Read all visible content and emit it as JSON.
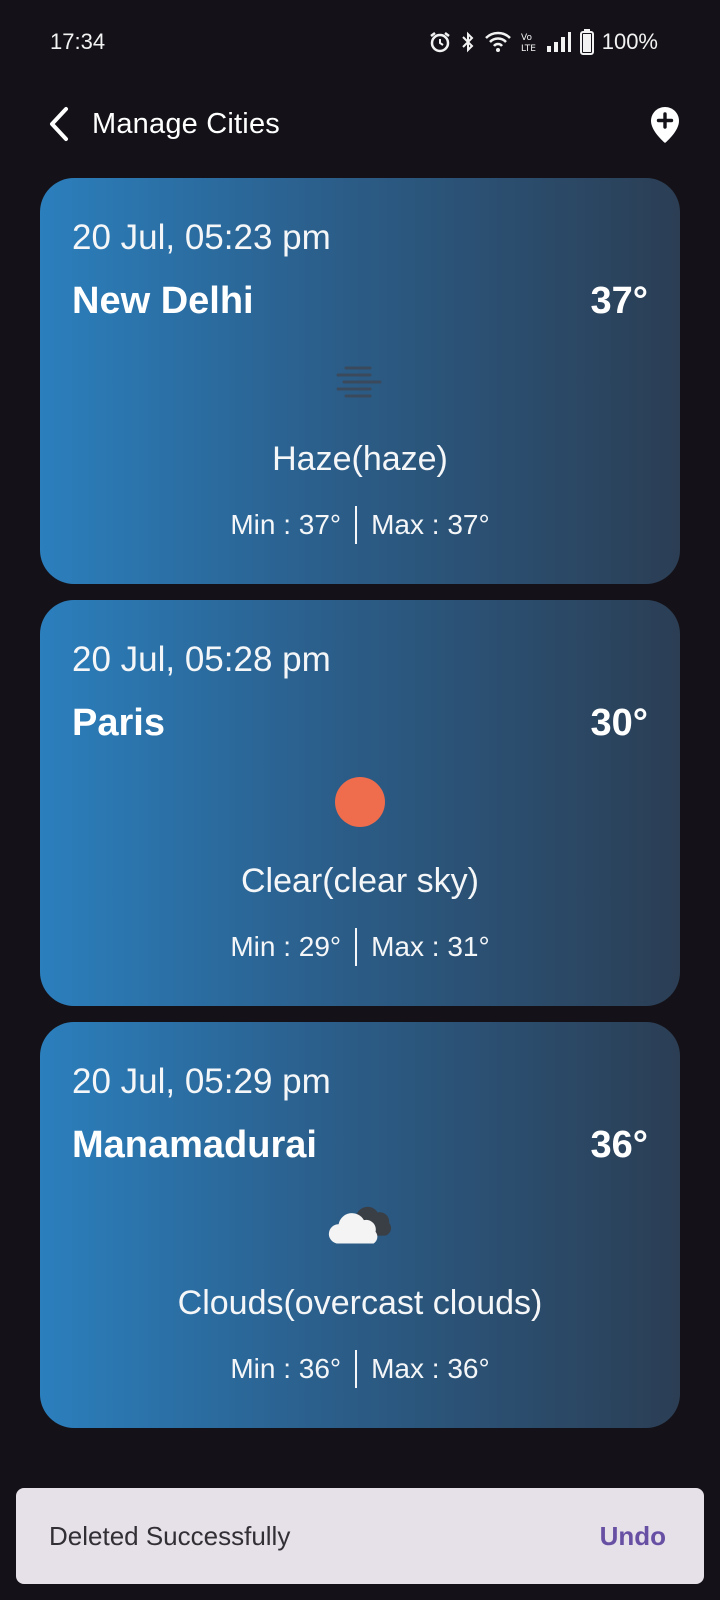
{
  "status_bar": {
    "time": "17:34",
    "battery": "100%",
    "icons": [
      "alarm-icon",
      "bluetooth-icon",
      "wifi-icon",
      "volte-icon",
      "signal-icon",
      "battery-icon"
    ]
  },
  "header": {
    "title": "Manage Cities",
    "back_icon": "chevron-left-icon",
    "add_icon": "add-location-icon"
  },
  "cities": [
    {
      "datetime": "20 Jul, 05:23 pm",
      "name": "New Delhi",
      "temp": "37°",
      "icon": "haze-icon",
      "description": "Haze(haze)",
      "min": "Min : 37°",
      "max": "Max : 37°"
    },
    {
      "datetime": "20 Jul, 05:28 pm",
      "name": "Paris",
      "temp": "30°",
      "icon": "sun-icon",
      "description": "Clear(clear sky)",
      "min": "Min : 29°",
      "max": "Max : 31°"
    },
    {
      "datetime": "20 Jul, 05:29 pm",
      "name": "Manamadurai",
      "temp": "36°",
      "icon": "cloud-icon",
      "description": "Clouds(overcast clouds)",
      "min": "Min : 36°",
      "max": "Max : 36°"
    }
  ],
  "snackbar": {
    "message": "Deleted Successfully",
    "action": "Undo"
  },
  "colors": {
    "background": "#141218",
    "card_gradient_start": "#2b7fbd",
    "card_gradient_end": "#2b3e54",
    "sun": "#ef6c4c",
    "snackbar_bg": "#e6e0e9",
    "snackbar_action": "#6750a4"
  }
}
